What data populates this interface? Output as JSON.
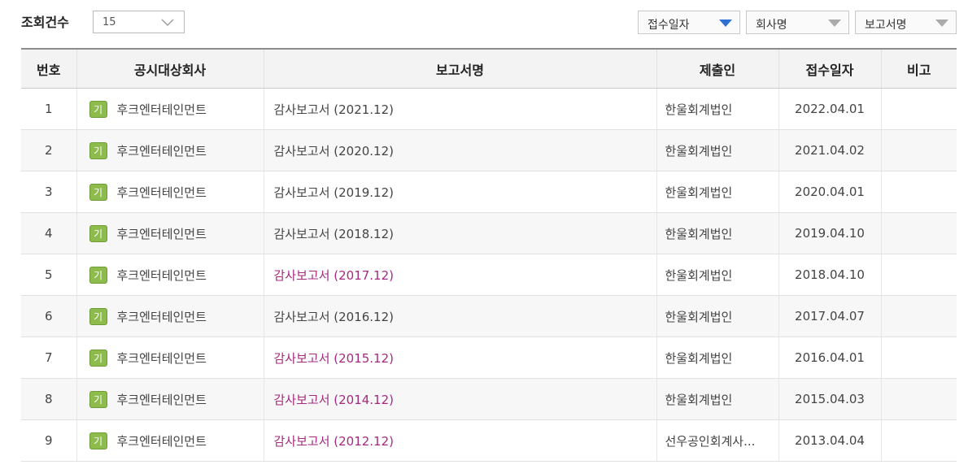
{
  "toolbar": {
    "count_label": "조회건수",
    "count_value": "15",
    "sort_options": [
      "접수일자",
      "회사명",
      "보고서명"
    ]
  },
  "colors": {
    "badge_green": "#8dbb4c",
    "visited_link": "#a5297f",
    "active_arrow": "#2d6fd6"
  },
  "table": {
    "headers": [
      "번호",
      "공시대상회사",
      "보고서명",
      "제출인",
      "접수일자",
      "비고"
    ],
    "rows": [
      {
        "no": "1",
        "badge": "기",
        "company": "후크엔터테인먼트",
        "report": "감사보고서 (2021.12)",
        "visited": false,
        "submitter": "한울회계법인",
        "date": "2022.04.01",
        "note": ""
      },
      {
        "no": "2",
        "badge": "기",
        "company": "후크엔터테인먼트",
        "report": "감사보고서 (2020.12)",
        "visited": false,
        "submitter": "한울회계법인",
        "date": "2021.04.02",
        "note": ""
      },
      {
        "no": "3",
        "badge": "기",
        "company": "후크엔터테인먼트",
        "report": "감사보고서 (2019.12)",
        "visited": false,
        "submitter": "한울회계법인",
        "date": "2020.04.01",
        "note": ""
      },
      {
        "no": "4",
        "badge": "기",
        "company": "후크엔터테인먼트",
        "report": "감사보고서 (2018.12)",
        "visited": false,
        "submitter": "한울회계법인",
        "date": "2019.04.10",
        "note": ""
      },
      {
        "no": "5",
        "badge": "기",
        "company": "후크엔터테인먼트",
        "report": "감사보고서 (2017.12)",
        "visited": true,
        "submitter": "한울회계법인",
        "date": "2018.04.10",
        "note": ""
      },
      {
        "no": "6",
        "badge": "기",
        "company": "후크엔터테인먼트",
        "report": "감사보고서 (2016.12)",
        "visited": false,
        "submitter": "한울회계법인",
        "date": "2017.04.07",
        "note": ""
      },
      {
        "no": "7",
        "badge": "기",
        "company": "후크엔터테인먼트",
        "report": "감사보고서 (2015.12)",
        "visited": true,
        "submitter": "한울회계법인",
        "date": "2016.04.01",
        "note": ""
      },
      {
        "no": "8",
        "badge": "기",
        "company": "후크엔터테인먼트",
        "report": "감사보고서 (2014.12)",
        "visited": true,
        "submitter": "한울회계법인",
        "date": "2015.04.03",
        "note": ""
      },
      {
        "no": "9",
        "badge": "기",
        "company": "후크엔터테인먼트",
        "report": "감사보고서 (2012.12)",
        "visited": true,
        "submitter": "선우공인회계사...",
        "date": "2013.04.04",
        "note": ""
      }
    ]
  }
}
